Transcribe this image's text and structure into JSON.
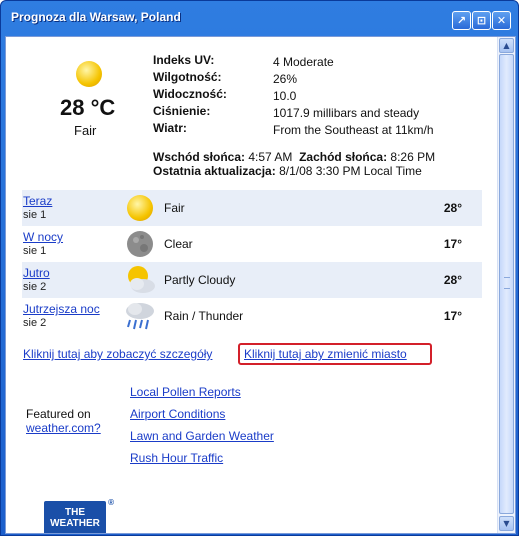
{
  "window": {
    "title": "Prognoza dla Warsaw, Poland"
  },
  "current": {
    "temp": "28 °C",
    "condition": "Fair",
    "details": [
      {
        "label": "Indeks UV:",
        "value": "4 Moderate"
      },
      {
        "label": "Wilgotność:",
        "value": "26%"
      },
      {
        "label": "Widoczność:",
        "value": "10.0"
      },
      {
        "label": "Ciśnienie:",
        "value": "1017.9 millibars and steady"
      },
      {
        "label": "Wiatr:",
        "value": "From the Southeast at 11km/h"
      }
    ],
    "sunrise_label": "Wschód słońca:",
    "sunrise": "4:57 AM",
    "sunset_label": "Zachód słońca:",
    "sunset": "8:26 PM",
    "updated_label": "Ostatnia aktualizacja:",
    "updated": "8/1/08 3:30 PM Local Time"
  },
  "forecast": [
    {
      "period": "Teraz",
      "date": "sie 1",
      "icon": "sun-icon",
      "condition": "Fair",
      "temp": "28°"
    },
    {
      "period": "W nocy",
      "date": "sie 1",
      "icon": "moon-icon",
      "condition": "Clear",
      "temp": "17°"
    },
    {
      "period": "Jutro",
      "date": "sie 2",
      "icon": "partly-cloudy-icon",
      "condition": "Partly Cloudy",
      "temp": "28°"
    },
    {
      "period": "Jutrzejsza noc",
      "date": "sie 2",
      "icon": "rain-thunder-icon",
      "condition": "Rain / Thunder",
      "temp": "17°"
    }
  ],
  "links": {
    "details": "Kliknij tutaj aby zobaczyć szczegóły",
    "change_city": "Kliknij tutaj aby zmienić miasto"
  },
  "featured": {
    "label": "Featured on",
    "site": "weather.com?"
  },
  "resources": [
    "Local Pollen Reports",
    "Airport Conditions",
    "Lawn and Garden Weather",
    "Rush Hour Traffic"
  ],
  "logo_text": "THE WEATHER",
  "colors": {
    "titlebar": "#1c5fcc",
    "link": "#1a3cc8",
    "highlight_box": "#d3202a",
    "row_shade": "#e8eef8"
  }
}
